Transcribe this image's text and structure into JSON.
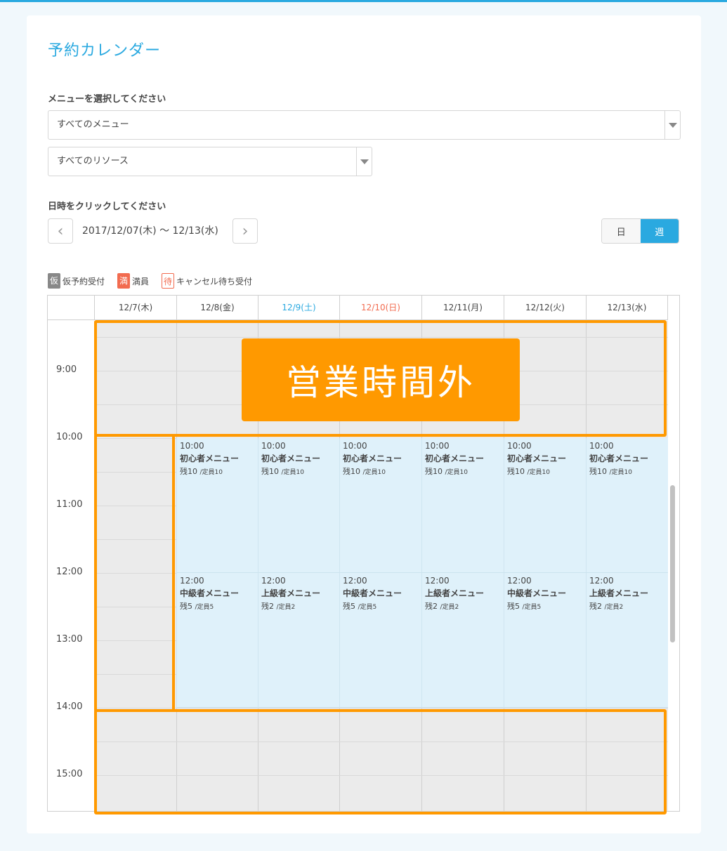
{
  "page_title": "予約カレンダー",
  "menu_label": "メニューを選択してください",
  "menu_select": "すべてのメニュー",
  "resource_select": "すべてのリソース",
  "date_label": "日時をクリックしてください",
  "date_range": "2017/12/07(木) 〜 12/13(水)",
  "view": {
    "day": "日",
    "week": "週"
  },
  "legend": [
    {
      "badge": "仮",
      "text": "仮予約受付"
    },
    {
      "badge": "満",
      "text": "満員"
    },
    {
      "badge": "待",
      "text": "キャンセル待ち受付"
    }
  ],
  "days": [
    "12/7(木)",
    "12/8(金)",
    "12/9(土)",
    "12/10(日)",
    "12/11(月)",
    "12/12(火)",
    "12/13(水)"
  ],
  "times": [
    "9:00",
    "10:00",
    "11:00",
    "12:00",
    "13:00",
    "14:00",
    "15:00"
  ],
  "slots_10": [
    {
      "time": "10:00",
      "menu": "初心者メニュー",
      "remain": "残10",
      "cap": "/定員10"
    },
    {
      "time": "10:00",
      "menu": "初心者メニュー",
      "remain": "残10",
      "cap": "/定員10"
    },
    {
      "time": "10:00",
      "menu": "初心者メニュー",
      "remain": "残10",
      "cap": "/定員10"
    },
    {
      "time": "10:00",
      "menu": "初心者メニュー",
      "remain": "残10",
      "cap": "/定員10"
    },
    {
      "time": "10:00",
      "menu": "初心者メニュー",
      "remain": "残10",
      "cap": "/定員10"
    },
    {
      "time": "10:00",
      "menu": "初心者メニュー",
      "remain": "残10",
      "cap": "/定員10"
    }
  ],
  "slots_12": [
    {
      "time": "12:00",
      "menu": "中級者メニュー",
      "remain": "残5",
      "cap": "/定員5"
    },
    {
      "time": "12:00",
      "menu": "上級者メニュー",
      "remain": "残2",
      "cap": "/定員2"
    },
    {
      "time": "12:00",
      "menu": "中級者メニュー",
      "remain": "残5",
      "cap": "/定員5"
    },
    {
      "time": "12:00",
      "menu": "上級者メニュー",
      "remain": "残2",
      "cap": "/定員2"
    },
    {
      "time": "12:00",
      "menu": "中級者メニュー",
      "remain": "残5",
      "cap": "/定員5"
    },
    {
      "time": "12:00",
      "menu": "上級者メニュー",
      "remain": "残2",
      "cap": "/定員2"
    }
  ],
  "overlay_text": "営業時間外",
  "colors": {
    "accent": "#2aa9e0",
    "sunday": "#f26b4f",
    "highlight": "#ff9900"
  }
}
